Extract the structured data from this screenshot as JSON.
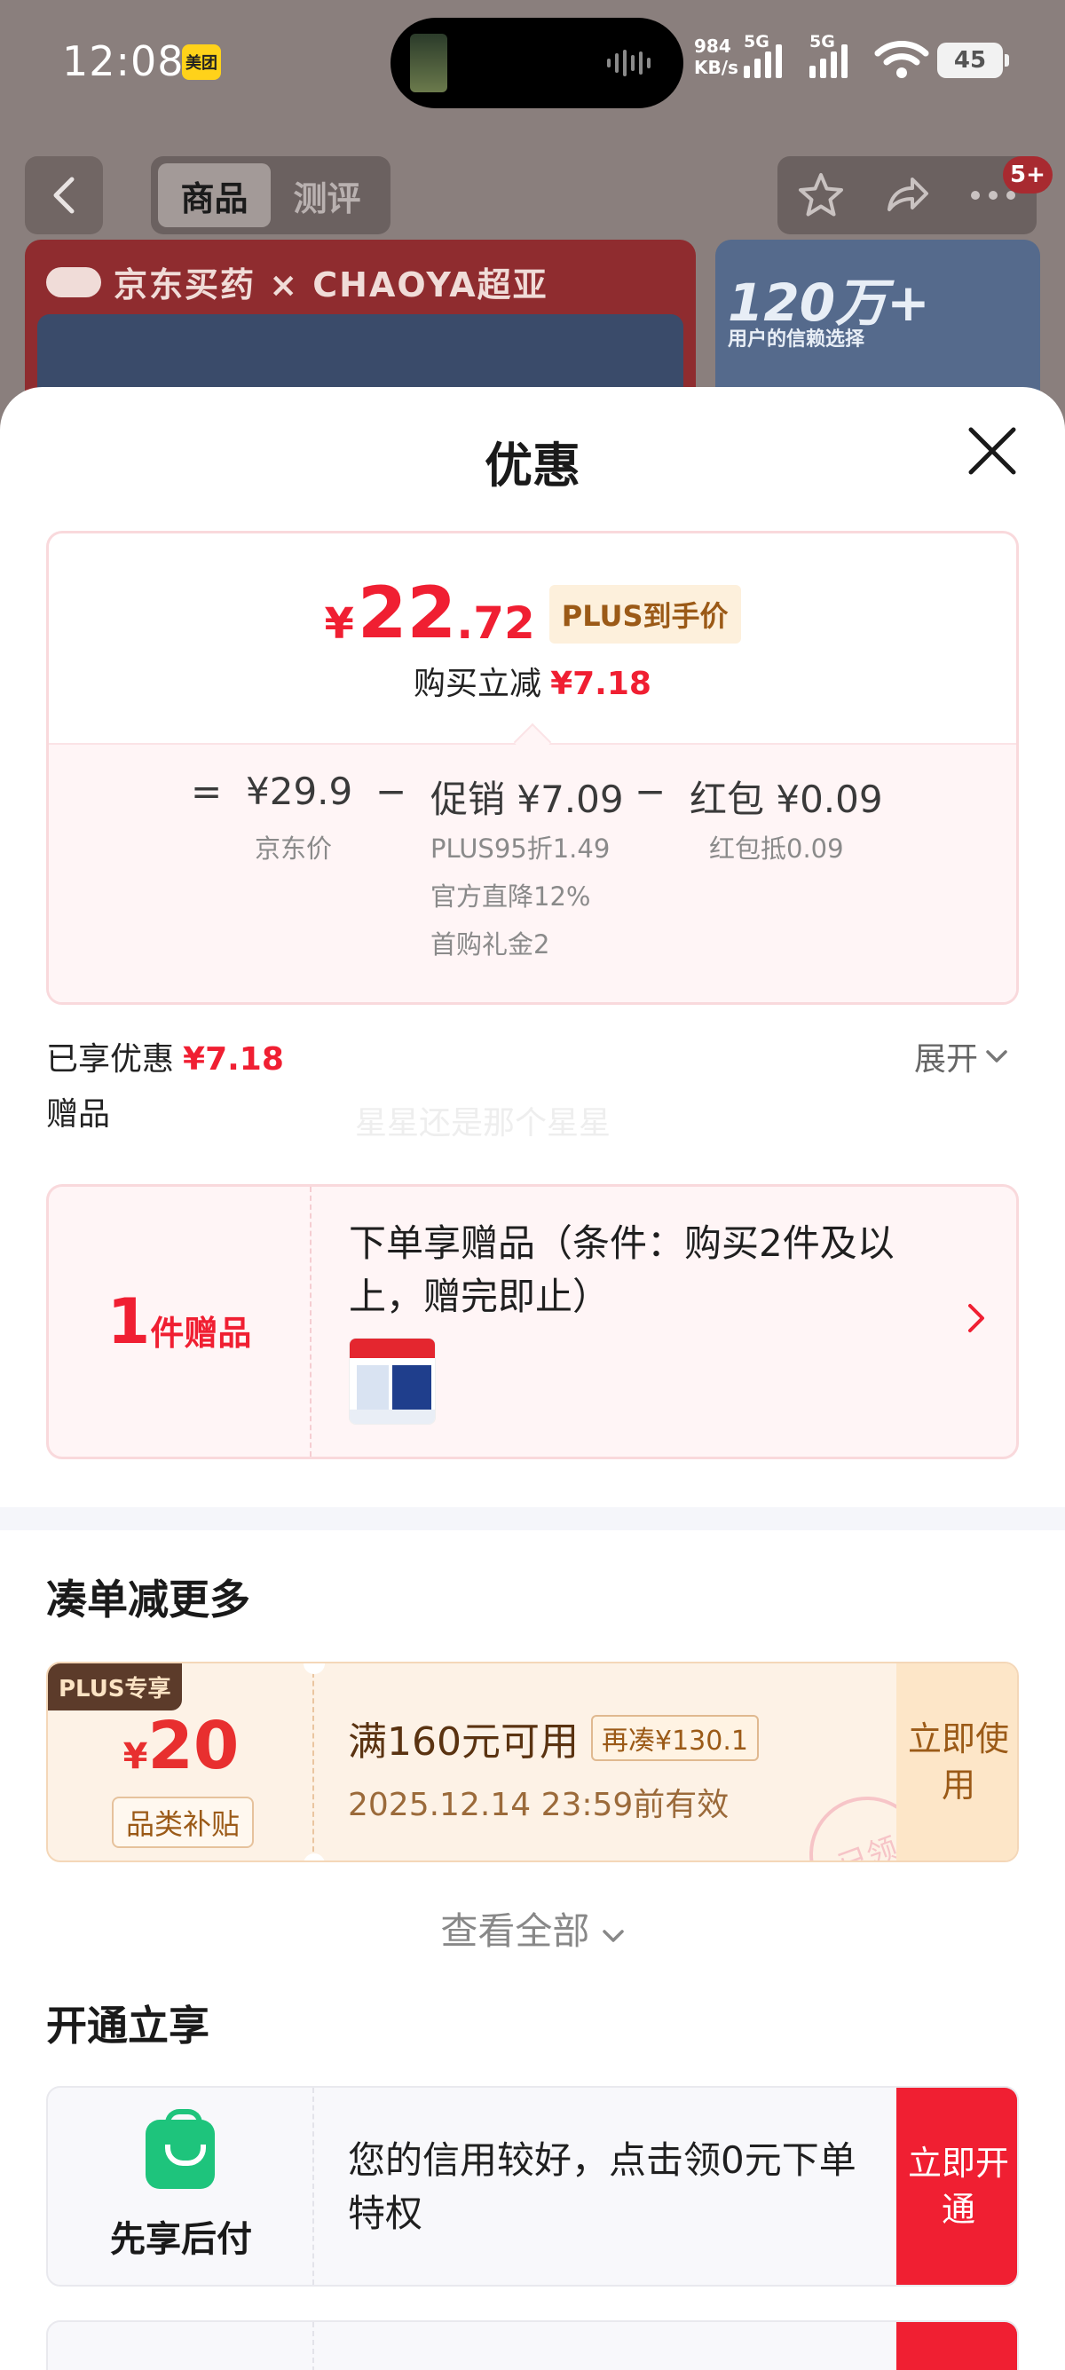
{
  "status_bar": {
    "time": "12:08",
    "app_badge": "美团",
    "net_speed_value": "984",
    "net_speed_unit": "KB/s",
    "sim1_label": "5G",
    "sim2_label": "5G",
    "battery": "45"
  },
  "nav": {
    "tabs": [
      {
        "label": "商品",
        "active": true
      },
      {
        "label": "测评",
        "active": false
      }
    ],
    "message_badge": "5+"
  },
  "banner": {
    "left_brand": "京东买药 × CHAOYA超亚",
    "right_headline": "120万+",
    "right_sub": "用户的信赖选择"
  },
  "sheet": {
    "title": "优惠",
    "final_price": {
      "currency": "¥",
      "integer": "22",
      "decimal": ".72"
    },
    "final_price_tag": "PLUS到手价",
    "instant_cut_label": "购买立减",
    "instant_cut_value": "¥7.18",
    "formula": {
      "equals": "=",
      "base_price": "¥29.9",
      "base_label": "京东价",
      "minus1": "−",
      "promo": "促销 ¥7.09",
      "promo_items": [
        "PLUS95折1.49",
        "官方直降12%",
        "首购礼金2"
      ],
      "minus2": "−",
      "redpacket": "红包 ¥0.09",
      "redpacket_label": "红包抵0.09"
    },
    "enjoyed_label": "已享优惠",
    "enjoyed_value": "¥7.18",
    "expand_label": "展开",
    "gift_section_label": "赠品",
    "watermark": "星星还是那个星星",
    "gift": {
      "count": "1",
      "count_label": "件赠品",
      "description": "下单享赠品（条件：购买2件及以上，赠完即止）"
    },
    "bundle_section_title": "凑单减更多",
    "coupon": {
      "tag": "PLUS专享",
      "currency": "¥",
      "amount": "20",
      "type": "品类补贴",
      "condition": "满160元可用",
      "again_tag": "再凑¥130.1",
      "expiry": "2025.12.14 23:59前有效",
      "use_label": "立即使用",
      "stamp": "已领"
    },
    "see_all_label": "查看全部",
    "open_section_title": "开通立享",
    "service": {
      "name": "先享后付",
      "description": "您的信用较好，点击领0元下单特权",
      "button_label": "立即开通"
    }
  },
  "colors": {
    "accent_red": "#f01f32",
    "plus_gold": "#9b5a17",
    "service_green": "#1ec47c"
  }
}
